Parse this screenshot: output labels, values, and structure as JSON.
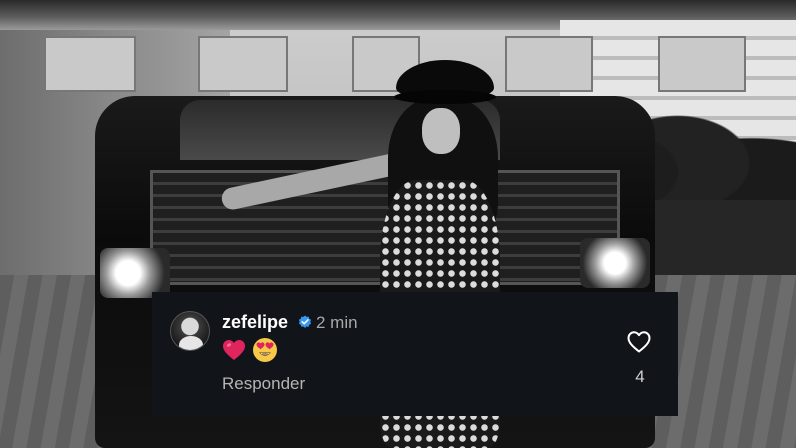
{
  "comment": {
    "username": "zefelipe",
    "verified": true,
    "timestamp": "2 min",
    "emojis": [
      "heart",
      "heart-eyes"
    ],
    "reply_label": "Responder",
    "like_count": "4"
  },
  "colors": {
    "card_background": "#111418",
    "verified_blue": "#3897f0",
    "heart_red": "#e0245e",
    "emoji_yellow": "#f7c948"
  },
  "icons": {
    "verified": "verified-badge-icon",
    "like": "heart-outline-icon"
  }
}
